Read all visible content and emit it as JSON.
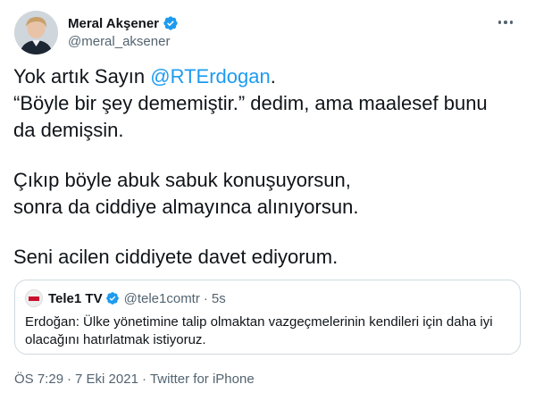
{
  "author": {
    "display_name": "Meral Akşener",
    "handle": "@meral_aksener"
  },
  "tweet": {
    "mention": "@RTErdogan",
    "line1_prefix": "Yok artık Sayın ",
    "line1_suffix": ".",
    "line2": "“Böyle bir şey dememiştir.” dedim, ama maalesef bunu",
    "line3": "da demişsin.",
    "line4": "Çıkıp böyle abuk sabuk konuşuyorsun,",
    "line5": "sonra da ciddiye almayınca alınıyorsun.",
    "line6": "Seni acilen ciddiyete davet ediyorum."
  },
  "quote": {
    "display_name": "Tele1 TV",
    "handle": "@tele1comtr",
    "separator": "·",
    "time": "5s",
    "text_line1": "Erdoğan: Ülke yönetimine talip olmaktan vazgeçmelerinin kendileri için daha iyi",
    "text_line2": "olacağını hatırlatmak istiyoruz."
  },
  "meta": {
    "time": "ÖS 7:29",
    "separator1": "·",
    "date": "7 Eki 2021",
    "separator2": "·",
    "client": "Twitter for iPhone"
  },
  "colors": {
    "accent": "#1d9bf0",
    "secondary_text": "#536471",
    "border": "#cfd9de"
  },
  "icons": {
    "verified": "verified-badge-icon",
    "more": "more-options-icon"
  }
}
